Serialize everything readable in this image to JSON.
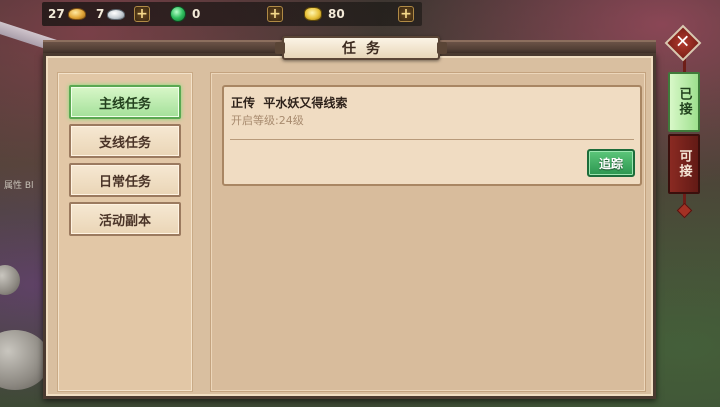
{
  "resources": {
    "gold": "27",
    "silver": "7",
    "jade": "0",
    "ingot": "80"
  },
  "panel": {
    "title": "任务"
  },
  "categories": [
    {
      "label": "主线任务",
      "active": true
    },
    {
      "label": "支线任务",
      "active": false
    },
    {
      "label": "日常任务",
      "active": false
    },
    {
      "label": "活动副本",
      "active": false
    }
  ],
  "quest": {
    "title": "正传  平水妖又得线索",
    "level_text": "开启等级:24级",
    "track_label": "追踪"
  },
  "side_tabs": {
    "accepted": "已接",
    "available": "可接"
  },
  "close_icon": "close-icon",
  "background_text": "属性  Bl",
  "colors": {
    "active_green": "#a4e09a",
    "track_green": "#2c9650",
    "tab_red": "#621a15",
    "panel_bg": "#d9bfa0"
  }
}
